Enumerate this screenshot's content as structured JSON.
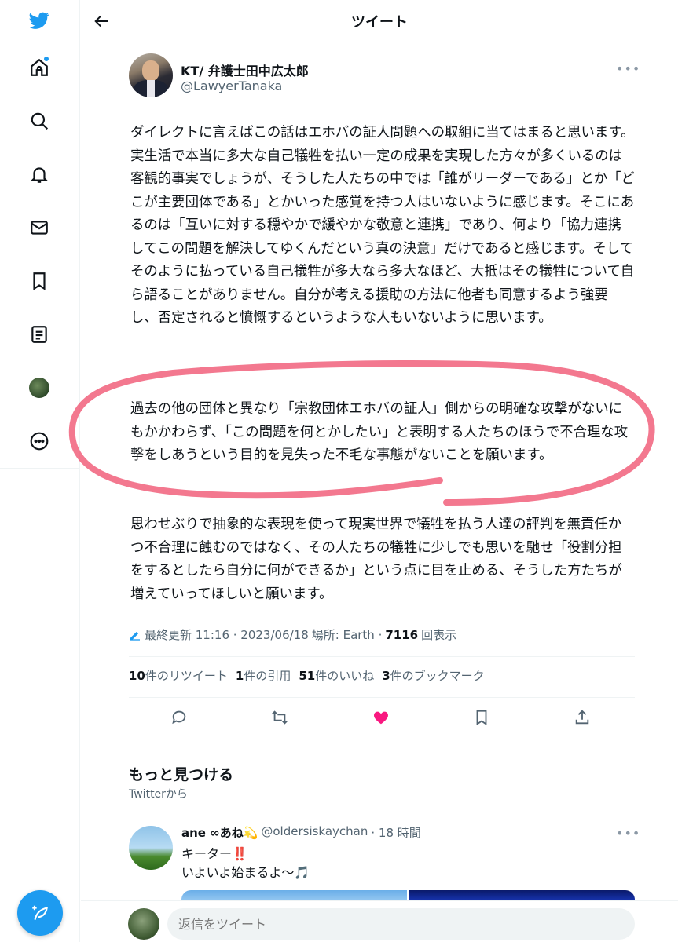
{
  "header": {
    "title": "ツイート"
  },
  "nav": {
    "items": [
      {
        "name": "twitter-logo-icon"
      },
      {
        "name": "home-icon"
      },
      {
        "name": "search-icon"
      },
      {
        "name": "notifications-icon"
      },
      {
        "name": "messages-icon"
      },
      {
        "name": "bookmarks-icon"
      },
      {
        "name": "lists-icon"
      },
      {
        "name": "profile-avatar"
      },
      {
        "name": "more-icon"
      }
    ],
    "compose_icon": "compose-tweet-icon",
    "accent": "#1d9bf0"
  },
  "tweet": {
    "author_name": "KT/ 弁護士田中広太郎",
    "author_handle": "@LawyerTanaka",
    "paragraph1": "ダイレクトに言えばこの話はエホバの証人問題への取組に当てはまると思います。\n実生活で本当に多大な自己犠牲を払い一定の成果を実現した方々が多くいるのは客観的事実でしょうが、そうした人たちの中では「誰がリーダーである」とか「どこが主要団体である」とかいった感覚を持つ人はいないように感じます。そこにあるのは「互いに対する穏やかで緩やかな敬意と連携」であり、何より「協力連携してこの問題を解決してゆくんだという真の決意」だけであると感じます。そしてそのように払っている自己犠牲が多大なら多大なほど、大抵はその犠牲について自ら語ることがありません。自分が考える援助の方法に他者も同意するよう強要し、否定されると憤慨するというような人もいないように思います。",
    "paragraph2": "過去の他の団体と異なり「宗教団体エホバの証人」側からの明確な攻撃がないにもかかわらず、「この問題を何とかしたい」と表明する人たちのほうで不合理な攻撃をしあうという目的を見失った不毛な事態がないことを願います。",
    "paragraph3": "思わせぶりで抽象的な表現を使って現実世界で犠牲を払う人達の評判を無責任かつ不合理に蝕むのではなく、その人たちの犠牲に少しでも思いを馳せ「役割分担をするとしたら自分に何ができるか」という点に目を止める、そうした方たちが増えていってほしいと願います。",
    "meta": {
      "edited_label": "最終更新 11:16 · 2023/06/18",
      "location": "場所: Earth ·",
      "views_count": "7116",
      "views_label": "回表示"
    },
    "stats": {
      "retweets_count": "10",
      "retweets_label": "件のリツイート",
      "quotes_count": "1",
      "quotes_label": "件の引用",
      "likes_count": "51",
      "likes_label": "件のいいね",
      "bookmarks_count": "3",
      "bookmarks_label": "件のブックマーク"
    },
    "liked": true,
    "like_color": "#f91880",
    "highlight_color": "#ef4b6a"
  },
  "discover": {
    "title": "もっと見つける",
    "subtitle": "Twitterから",
    "item": {
      "name": "ane ∞あね💫",
      "handle": "@oldersiskaychan",
      "time": "· 18 時間",
      "text_line1": "キーター‼️",
      "text_line2": "いよいよ始まるよ〜🎵"
    }
  },
  "reply": {
    "placeholder": "返信をツイート"
  }
}
